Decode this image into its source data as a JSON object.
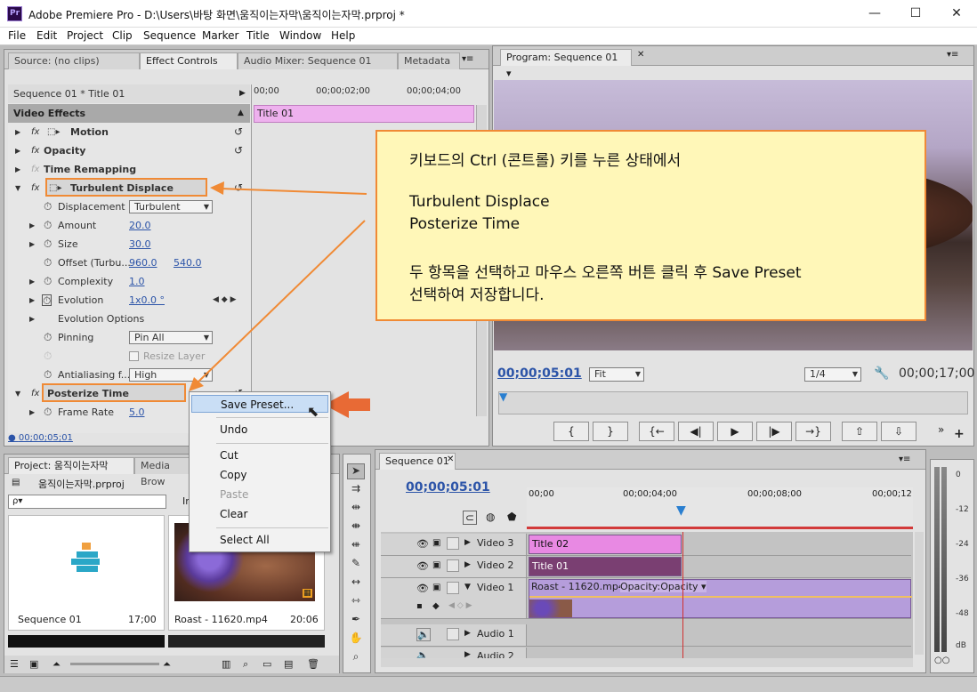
{
  "window": {
    "title": "Adobe Premiere Pro - D:\\Users\\바탕 화면\\움직이는자막\\움직이는자막.prproj *",
    "logo": "Pr",
    "min": "—",
    "max": "☐",
    "close": "✕"
  },
  "menu": [
    "File",
    "Edit",
    "Project",
    "Clip",
    "Sequence",
    "Marker",
    "Title",
    "Window",
    "Help"
  ],
  "source_panel": {
    "tabs": [
      "Source: (no clips)",
      "Effect Controls",
      "Audio Mixer: Sequence 01",
      "Metadata"
    ],
    "menu_icon": "▾≡"
  },
  "effect_controls": {
    "sequence_label": "Sequence 01 * Title 01",
    "ruler": [
      "00;00",
      "00;00;02;00",
      "00;00;04;00"
    ],
    "clip_bar": "Title 01",
    "header": "Video Effects",
    "rows": {
      "motion": "Motion",
      "opacity": "Opacity",
      "time_remap": "Time Remapping",
      "turbulent": "Turbulent Displace",
      "displacement": "Displacement",
      "displacement_val": "Turbulent",
      "amount": "Amount",
      "amount_val": "20.0",
      "size": "Size",
      "size_val": "30.0",
      "offset": "Offset (Turbu...",
      "offset_x": "960.0",
      "offset_y": "540.0",
      "complexity": "Complexity",
      "complexity_val": "1.0",
      "evolution": "Evolution",
      "evolution_val": "1x0.0 °",
      "evolution_opts": "Evolution Options",
      "pinning": "Pinning",
      "pinning_val": "Pin All",
      "resize": "Resize Layer",
      "antialias": "Antialiasing f...",
      "antialias_val": "High",
      "posterize": "Posterize Time",
      "framerate": "Frame Rate",
      "framerate_val": "5.0"
    },
    "timecode": "00;00;05;01",
    "fx": "fx"
  },
  "program": {
    "tab": "Program: Sequence 01",
    "timecode": "00;00;05:01",
    "fit": "Fit",
    "res": "1/4",
    "duration": "00;00;17;00",
    "buttons": [
      "{",
      "}",
      "{←",
      "◀|",
      "▶",
      "|▶",
      "→}",
      "⇧",
      "⇩"
    ]
  },
  "callout": {
    "line1": "키보드의 Ctrl (콘트롤) 키를 누른 상태에서",
    "line2": "Turbulent Displace",
    "line3": "Posterize Time",
    "line4": "두 항목을 선택하고 마우스 오른쪽 버튼 클릭 후 Save Preset",
    "line5": "선택하여 저장합니다."
  },
  "context_menu": [
    "Save Preset...",
    "Undo",
    "Cut",
    "Copy",
    "Paste",
    "Clear",
    "Select All"
  ],
  "project": {
    "tabs": [
      "Project: 움직이는자막",
      "Media Brow"
    ],
    "file": "움직이는자막.prproj",
    "search_placeholder": "ρ▾",
    "in_label": "In",
    "items": [
      {
        "name": "Sequence 01",
        "dur": "17;00"
      },
      {
        "name": "Roast - 11620.mp4",
        "dur": "20:06"
      }
    ]
  },
  "timeline": {
    "tab": "Sequence 01",
    "timecode": "00;00;05:01",
    "ruler": [
      "00;00",
      "00;00;04;00",
      "00;00;08;00",
      "00;00;12"
    ],
    "tracks": [
      {
        "name": "Video 3",
        "clip": "Title 02"
      },
      {
        "name": "Video 2",
        "clip": "Title 01"
      },
      {
        "name": "Video 1",
        "clip": "Roast - 11620.mp4",
        "clip2": "Opacity:Opacity ▾"
      },
      {
        "name": "Audio 1"
      },
      {
        "name": "Audio 2"
      }
    ]
  },
  "meter_labels": [
    "0",
    "-12",
    "-24",
    "-36",
    "-48",
    "dB"
  ],
  "colors": {
    "accent_orange": "#f08a35",
    "callout_bg": "#fff7b8",
    "title_clip": "#e889e3",
    "title_clip_dark": "#7a3f72",
    "video_clip": "#b59ddb",
    "timecode_blue": "#2c54a8"
  }
}
